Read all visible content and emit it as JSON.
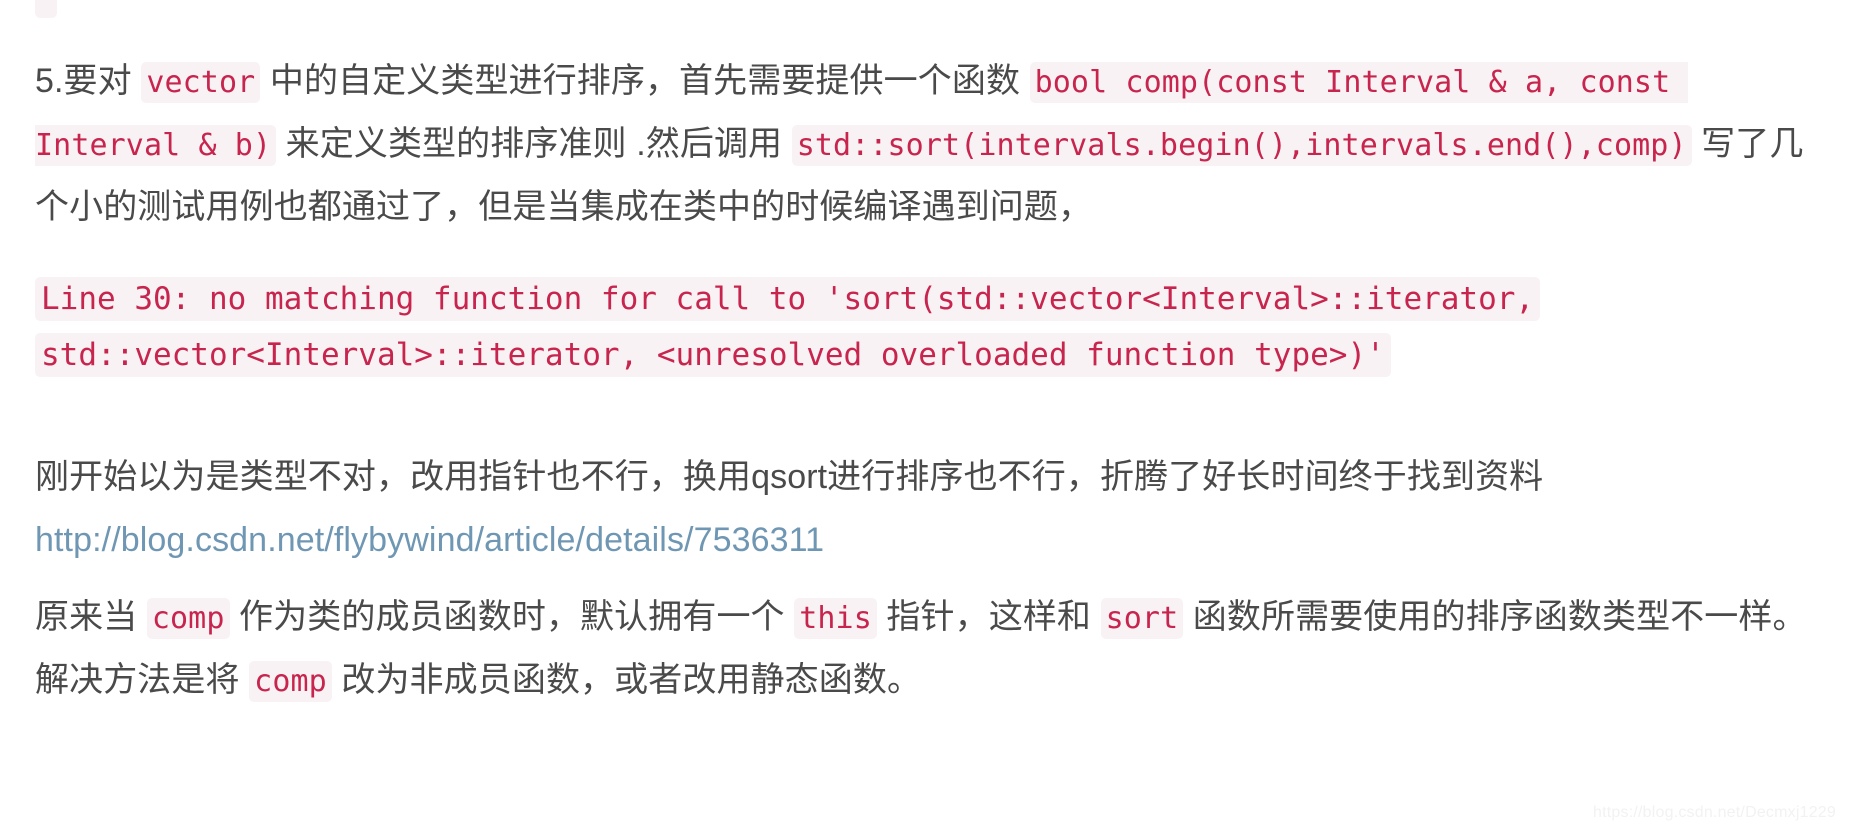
{
  "document": {
    "top_code_stub_color": "#f9f2f4",
    "text_color": "#4a4a4a",
    "code_bg_color": "#f9f2f4",
    "code_text_color": "#c7254e",
    "link_color": "#6f97b3",
    "background_color": "#ffffff"
  },
  "paragraphs": {
    "intro": {
      "seg1": "5.要对 ",
      "code1": "vector",
      "seg2": " 中的自定义类型进行排序，首先需要提供一个函数 ",
      "code2": "bool comp(const Interval & a, const Interval & b)",
      "seg3": " 来定义类型的排序准则 .然后调用 ",
      "code3": "std::sort(intervals.begin(),intervals.end(),comp)",
      "seg4": " 写了几个小的测试用例也都通过了，但是当集成在类中的时候编译遇到问题，"
    },
    "error_block": {
      "line1": " Line 30: no matching function for call to 'sort(std::vector<Interval>::iterator,",
      "line2": "std::vector<Interval>::iterator, <unresolved overloaded function type>)'"
    },
    "middle": {
      "seg1": "刚开始以为是类型不对，改用指针也不行，换用qsort进行排序也不行，折腾了好长时间终于找到资料",
      "link_text": "http://blog.csdn.net/flybywind/article/details/7536311"
    },
    "conclusion": {
      "seg1": "原来当 ",
      "code1": "comp",
      "seg2": " 作为类的成员函数时，默认拥有一个 ",
      "code2": "this",
      "seg3": " 指针，这样和 ",
      "code3": "sort",
      "seg4": " 函数所需要使用的排序函数类型不一样。解决方法是将 ",
      "code4": "comp",
      "seg5": " 改为非成员函数，或者改用静态函数。"
    }
  },
  "watermark": {
    "text": "https://blog.csdn.net/Decmxj1229"
  }
}
